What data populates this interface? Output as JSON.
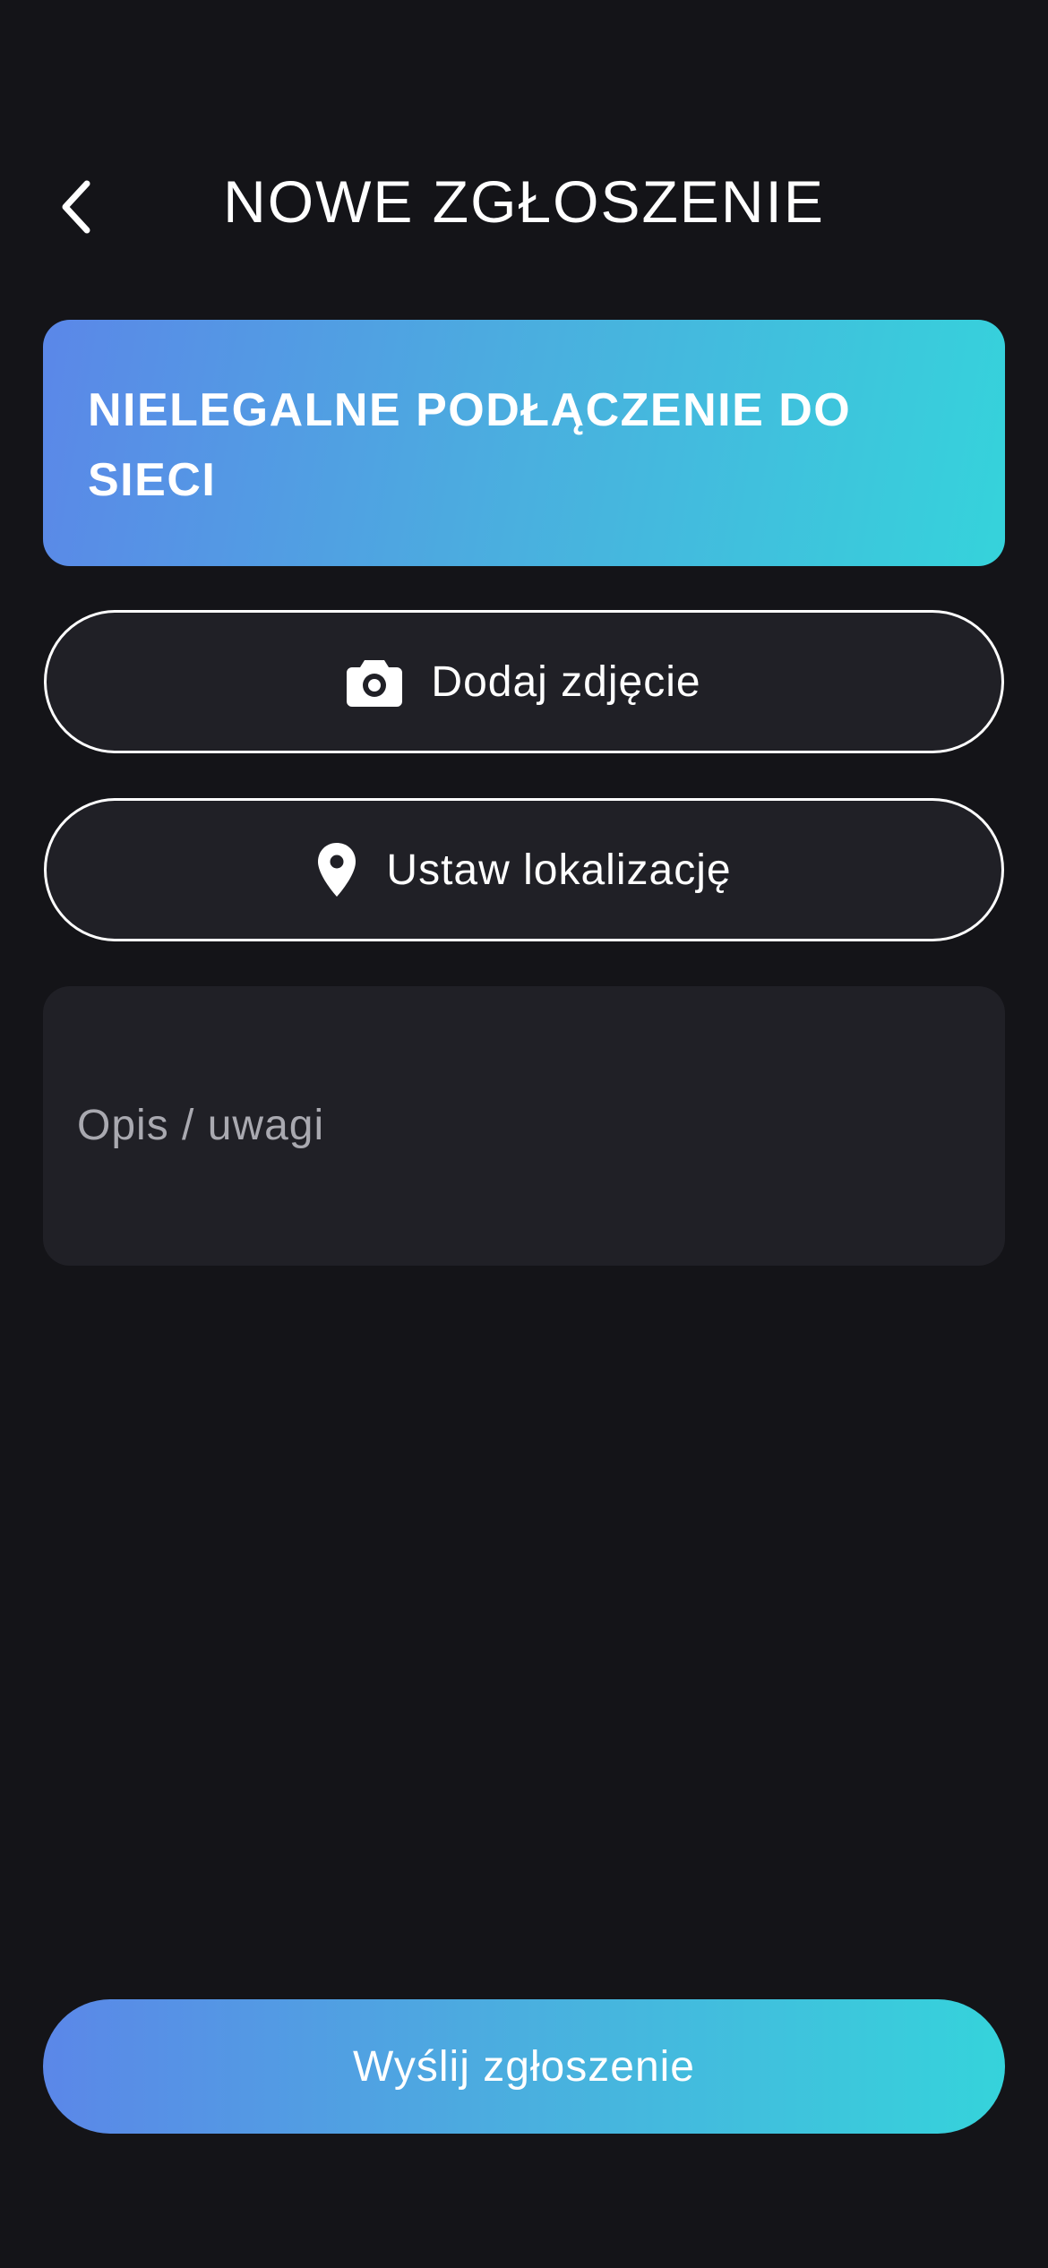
{
  "header": {
    "title": "NOWE ZGŁOSZENIE",
    "back_icon": "chevron-left-icon"
  },
  "category": {
    "title": "NIELEGALNE PODŁĄCZENIE DO SIECI"
  },
  "actions": {
    "add_photo_label": "Dodaj zdjęcie",
    "add_photo_icon": "camera-icon",
    "set_location_label": "Ustaw lokalizację",
    "set_location_icon": "map-pin-icon"
  },
  "description": {
    "placeholder": "Opis / uwagi",
    "value": ""
  },
  "submit": {
    "label": "Wyślij zgłoszenie"
  },
  "colors": {
    "background": "#141418",
    "surface": "#202026",
    "gradient_start": "#5b87e8",
    "gradient_end": "#35d3db",
    "text": "#ffffff",
    "placeholder": "#a9a9b0"
  }
}
